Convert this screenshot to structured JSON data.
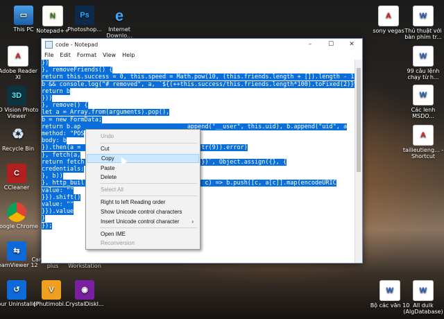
{
  "desktop": {
    "icons_left": [
      {
        "name": "this-pc",
        "label": "This PC",
        "icon": "pc-icon"
      },
      {
        "name": "notepadpp",
        "label": "Notepad++",
        "icon": "notepadpp-icon"
      },
      {
        "name": "photoshop",
        "label": "Photoshop...",
        "icon": "photoshop-icon"
      },
      {
        "name": "ie",
        "label": "Internet Downlo...",
        "icon": "ie-icon"
      },
      {
        "name": "adobe-reader",
        "label": "Adobe Reader XI",
        "icon": "pdf-icon"
      },
      {
        "name": "3d-vision",
        "label": "3D Vision Photo Viewer",
        "icon": "3d-icon"
      },
      {
        "name": "recycle-bin",
        "label": "Recycle Bin",
        "icon": "recycle-bin-icon"
      },
      {
        "name": "ccleaner",
        "label": "CCleaner",
        "icon": "ccleaner-icon"
      },
      {
        "name": "chrome",
        "label": "Google Chrome",
        "icon": "chrome-icon"
      },
      {
        "name": "teamviewer",
        "label": "TeamViewer 12",
        "icon": "teamviewer-icon"
      },
      {
        "name": "uninstaller",
        "label": "Your Uninstaller",
        "icon": "uninstaller-icon"
      },
      {
        "name": "phutimobi",
        "label": "[Phutimobi...",
        "icon": "php-icon"
      },
      {
        "name": "crystaldisk",
        "label": "CrystalDiskI...",
        "icon": "crystaldisk-icon"
      },
      {
        "name": "camtasia",
        "label": "Camtasia Stu... plus",
        "icon": "camtasia-icon"
      },
      {
        "name": "vmware",
        "label": "VMware Workstation",
        "icon": "vmware-icon"
      }
    ],
    "icons_right": [
      {
        "name": "sony-vegas",
        "label": "sony vegas",
        "icon": "pdf-icon"
      },
      {
        "name": "thu-thuat",
        "label": "Thủ thuật với bàn phím tr...",
        "icon": "doc-icon"
      },
      {
        "name": "99-cau",
        "label": "99 câu lệnh chạy từ h...",
        "icon": "doc-icon"
      },
      {
        "name": "cac-lenh",
        "label": "Các lenh MSDO...",
        "icon": "doc-icon"
      },
      {
        "name": "tailieu",
        "label": "tailieutieng... - Shortcut",
        "icon": "pdf-icon"
      },
      {
        "name": "bo-cac-van",
        "label": "Bộ các văn 10",
        "icon": "doc-icon"
      },
      {
        "name": "all-dulk",
        "label": "All dulk (AlgDatabase)",
        "icon": "doc-icon"
      }
    ]
  },
  "window": {
    "title": "code - Notepad",
    "menu": [
      "File",
      "Edit",
      "Format",
      "View",
      "Help"
    ],
    "controls": {
      "minimize": "–",
      "maximize": "☐",
      "close": "✕"
    }
  },
  "editor": {
    "lines": [
      "})",
      "}, removeFriends() {",
      "return this.success = 0, this.speed = Math.pow(10, (this.friends.length + []).length - 1)",
      "b && console.log(\"# removed\", a, `${(++this.success/this.friends.length*100).toFixed(2)}%",
      "return b",
      "}))",
      "}, remove() {",
      "let a = Array.from(arguments).pop(),",
      "b = new FormData;",
      "return b.ap                              append(\"__user\", this.uid), b.append(\"uid\", a",
      "method: \"POS",
      "body: b",
      "}).then(a =                            a.substr(9)).error)",
      "}, fetch(a,",
      "return fetch                           qs||{}})`, Object.assign({}, {",
      "credentials:",
      "}, b))",
      "}, http_buil                           ce((b, c) => b.push([c, a[c]].map(encodeURIC",
      "value: \"\"",
      "}}).shift()",
      "value: \"\"",
      "}}).value",
      "}",
      "});"
    ]
  },
  "context_menu": {
    "items": [
      {
        "label": "Undo",
        "disabled": true
      },
      {
        "label": "Cut",
        "disabled": false
      },
      {
        "label": "Copy",
        "disabled": false,
        "highlighted": true
      },
      {
        "label": "Paste",
        "disabled": false
      },
      {
        "label": "Delete",
        "disabled": false
      },
      {
        "label": "Select All",
        "disabled": true
      },
      {
        "label": "Right to left Reading order",
        "disabled": false
      },
      {
        "label": "Show Unicode control characters",
        "disabled": false
      },
      {
        "label": "Insert Unicode control character",
        "disabled": false,
        "submenu": true
      },
      {
        "label": "Open IME",
        "disabled": false
      },
      {
        "label": "Reconversion",
        "disabled": true
      }
    ],
    "submenu_arrow": "›"
  },
  "colors": {
    "selection": "#0a6fdb",
    "menu_highlight": "#cce8ff"
  }
}
